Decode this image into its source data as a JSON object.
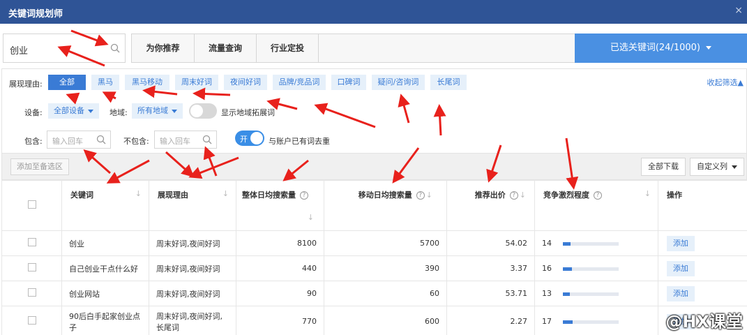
{
  "window": {
    "title": "关键词规划师",
    "close_glyph": "×"
  },
  "search": {
    "value": "创业",
    "icon": "search-icon"
  },
  "tabs": [
    {
      "label": "为你推荐"
    },
    {
      "label": "流量查询"
    },
    {
      "label": "行业定投"
    }
  ],
  "selected_keywords": {
    "label": "已选关键词(24/1000)"
  },
  "filters": {
    "reason_label": "展现理由:",
    "reasons": [
      "全部",
      "黑马",
      "黑马移动",
      "周末好词",
      "夜间好词",
      "品牌/竞品词",
      "口碑词",
      "疑问/咨询词",
      "长尾词"
    ],
    "active_reason": "全部",
    "collapse_label": "收起筛选▲",
    "device_label": "设备:",
    "device_value": "全部设备",
    "region_label": "地域:",
    "region_value": "所有地域",
    "show_region_label": "显示地域拓展词",
    "show_region_on": false,
    "include_label": "包含:",
    "include_placeholder": "输入回车",
    "exclude_label": "不包含:",
    "exclude_placeholder": "输入回车",
    "dedup_toggle_text": "开",
    "dedup_on": true,
    "dedup_label": "与账户已有词去重"
  },
  "toolbar": {
    "add_candidate_label": "添加至备选区",
    "download_all_label": "全部下载",
    "custom_columns_label": "自定义列"
  },
  "table": {
    "columns": [
      "关键词",
      "展现理由",
      "整体日均搜索量",
      "移动日均搜索量",
      "推荐出价",
      "竞争激烈程度",
      "操作"
    ],
    "help_glyph": "?",
    "sort_glyph": "↓",
    "rows": [
      {
        "keyword": "创业",
        "reason": "周末好词,夜间好词",
        "overall": "8100",
        "mobile": "5700",
        "bid": "54.02",
        "competition": "14",
        "competition_level": 0.14,
        "action": "添加"
      },
      {
        "keyword": "自己创业干点什么好",
        "reason": "周末好词,夜间好词",
        "overall": "440",
        "mobile": "390",
        "bid": "3.37",
        "competition": "16",
        "competition_level": 0.16,
        "action": "添加"
      },
      {
        "keyword": "创业网站",
        "reason": "周末好词,夜间好词",
        "overall": "90",
        "mobile": "60",
        "bid": "53.71",
        "competition": "13",
        "competition_level": 0.13,
        "action": "添加"
      },
      {
        "keyword": "90后白手起家创业点子",
        "reason": "周末好词,夜间好词,长尾词",
        "overall": "770",
        "mobile": "600",
        "bid": "2.27",
        "competition": "17",
        "competition_level": 0.17,
        "action": "添加"
      }
    ]
  },
  "watermark": "@HX课堂",
  "colors": {
    "header_bg": "#2f5496",
    "accent": "#3a7bd5",
    "selected_btn": "#4a90e2",
    "arrow": "#e8211c"
  }
}
